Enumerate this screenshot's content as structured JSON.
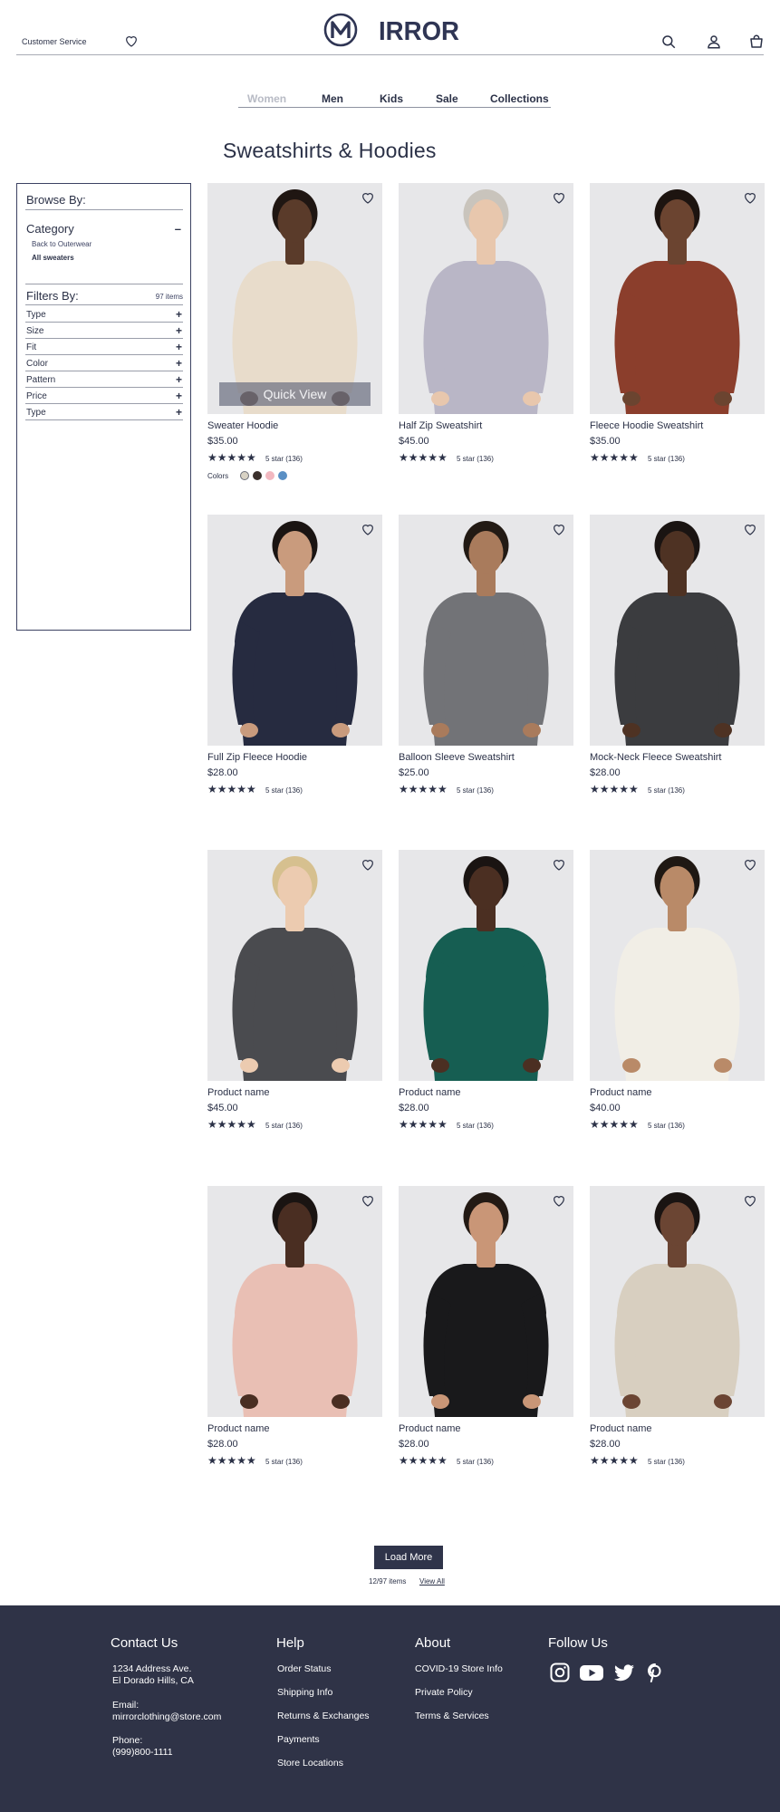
{
  "header": {
    "customer_service": "Customer Service",
    "logo": "MIRROR"
  },
  "nav": {
    "items": [
      "Women",
      "Men",
      "Kids",
      "Sale",
      "Collections"
    ],
    "active": "Women"
  },
  "page_title": "Sweatshirts & Hoodies",
  "sidebar": {
    "browse_by": "Browse By:",
    "category": "Category",
    "category_links": [
      "Back to Outerwear",
      "All sweaters"
    ],
    "filters_by": "Filters By:",
    "item_count": "97 items",
    "filters": [
      "Type",
      "Size",
      "Fit",
      "Color",
      "Pattern",
      "Price",
      "Type"
    ]
  },
  "quick_view": "Quick View",
  "colors_label": "Colors",
  "swatches": [
    "#d8d2c4",
    "#3b302c",
    "#f2b8c0",
    "#5a8fc4"
  ],
  "products": [
    {
      "name": "Sweater Hoodie",
      "price": "$35.00",
      "stars": "★★★★★",
      "rating": "5 star (136)",
      "garment": "#e8dccb",
      "skin": "#5a3b2a",
      "hair": "#1f1612",
      "pants": "#e8dccb"
    },
    {
      "name": "Half Zip Sweatshirt",
      "price": "$45.00",
      "stars": "★★★★★",
      "rating": "5 star (136)",
      "garment": "#b9b6c6",
      "skin": "#e8c7ad",
      "hair": "#c9c4bc",
      "pants": "#1c1c1f"
    },
    {
      "name": "Fleece Hoodie Sweatshirt",
      "price": "$35.00",
      "stars": "★★★★★",
      "rating": "5 star (136)",
      "garment": "#8b3e2c",
      "skin": "#6b4430",
      "hair": "#1d1410",
      "pants": "#1a1a1c"
    },
    {
      "name": "Full Zip Fleece Hoodie",
      "price": "$28.00",
      "stars": "★★★★★",
      "rating": "5 star (136)",
      "garment": "#262b40",
      "skin": "#c99b7d",
      "hair": "#1a1412",
      "pants": "#3f5a7c"
    },
    {
      "name": "Balloon Sleeve Sweatshirt",
      "price": "$25.00",
      "stars": "★★★★★",
      "rating": "5 star (136)",
      "garment": "#727377",
      "skin": "#a97b5c",
      "hair": "#221a14",
      "pants": "#4d6685"
    },
    {
      "name": "Mock-Neck Fleece Sweatshirt",
      "price": "$28.00",
      "stars": "★★★★★",
      "rating": "5 star (136)",
      "garment": "#3b3c3f",
      "skin": "#4e3223",
      "hair": "#1a1412",
      "pants": "#3d3d2a"
    },
    {
      "name": "Product name",
      "price": "$45.00",
      "stars": "★★★★★",
      "rating": "5 star (136)",
      "garment": "#4a4b4f",
      "skin": "#eccbb0",
      "hair": "#d6c08f",
      "pants": "#18181a"
    },
    {
      "name": "Product name",
      "price": "$28.00",
      "stars": "★★★★★",
      "rating": "5 star (136)",
      "garment": "#165e52",
      "skin": "#4b2f22",
      "hair": "#1a1412",
      "pants": "#2f4a66"
    },
    {
      "name": "Product name",
      "price": "$40.00",
      "stars": "★★★★★",
      "rating": "5 star (136)",
      "garment": "#f1eee6",
      "skin": "#b98a68",
      "hair": "#1f1813",
      "pants": "#3a3a36"
    },
    {
      "name": "Product name",
      "price": "$28.00",
      "stars": "★★★★★",
      "rating": "5 star (136)",
      "garment": "#e9bfb4",
      "skin": "#4a2e22",
      "hair": "#1a1412",
      "pants": "#e9bfb4"
    },
    {
      "name": "Product name",
      "price": "$28.00",
      "stars": "★★★★★",
      "rating": "5 star (136)",
      "garment": "#19191b",
      "skin": "#c99677",
      "hair": "#231a14",
      "pants": "#f2f2ee"
    },
    {
      "name": "Product name",
      "price": "$28.00",
      "stars": "★★★★★",
      "rating": "5 star (136)",
      "garment": "#d8cfc0",
      "skin": "#6b4533",
      "hair": "#1a1412",
      "pants": "#d8cfc0"
    }
  ],
  "load_more": "Load More",
  "load_status": "12/97 items",
  "view_all": "View All",
  "footer": {
    "contact_title": "Contact Us",
    "address_line1": "1234 Address Ave.",
    "address_line2": "El Dorado Hills, CA",
    "email_label": "Email:",
    "email": "mirrorclothing@store.com",
    "phone_label": "Phone:",
    "phone": "(999)800-1111",
    "help_title": "Help",
    "help_links": [
      "Order Status",
      "Shipping Info",
      "Returns & Exchanges",
      "Payments",
      "Store Locations"
    ],
    "about_title": "About",
    "about_links": [
      "COVID-19 Store Info",
      "Private Policy",
      "Terms & Services"
    ],
    "follow_title": "Follow Us",
    "social": [
      "instagram-icon",
      "youtube-icon",
      "twitter-icon",
      "pinterest-icon"
    ]
  }
}
